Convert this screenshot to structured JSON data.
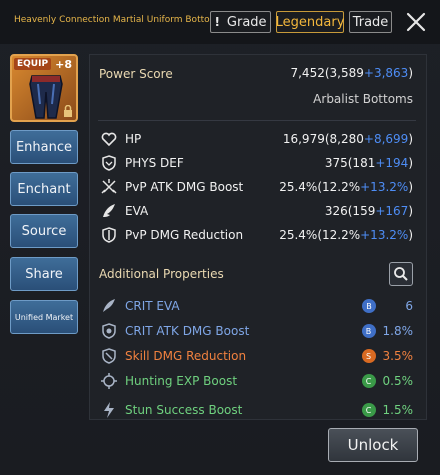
{
  "header": {
    "item_name": "Heavenly Connection Martial Uniform Bottom",
    "item_plus": "+8",
    "grade_label": "Grade",
    "legendary_label": "Legendary",
    "trade_label": "Trade"
  },
  "equip": {
    "tag": "EQUIP",
    "level": "+8"
  },
  "side_buttons": {
    "enhance": "Enhance",
    "enchant": "Enchant",
    "source": "Source",
    "share": "Share",
    "unified_market": "Unified Market"
  },
  "power": {
    "label": "Power Score",
    "value": "7,452",
    "base": "(3,589",
    "bonus": "+3,863",
    "close": ")",
    "item_type": "Arbalist Bottoms"
  },
  "stats": [
    {
      "name": "HP",
      "value": "16,979",
      "base": "(8,280",
      "bonus": "+8,699",
      "close": ")",
      "icon": "heart-icon"
    },
    {
      "name": "PHYS DEF",
      "value": "375",
      "base": "(181",
      "bonus": "+194",
      "close": ")",
      "icon": "shield-icon"
    },
    {
      "name": "PvP ATK DMG Boost",
      "value": "25.4%",
      "base": "(12.2%",
      "bonus": "+13.2%",
      "close": ")",
      "icon": "swords-icon"
    },
    {
      "name": "EVA",
      "value": "326",
      "base": "(159",
      "bonus": "+167",
      "close": ")",
      "icon": "wing-icon"
    },
    {
      "name": "PvP DMG Reduction",
      "value": "25.4%",
      "base": "(12.2%",
      "bonus": "+13.2%",
      "close": ")",
      "icon": "shield-sword-icon"
    }
  ],
  "additional": {
    "title": "Additional Properties",
    "items": [
      {
        "name": "CRIT EVA",
        "grade": "B",
        "value": "6",
        "color": "#7fa6e6",
        "badge_color": "#3f6fc6",
        "icon": "crit-eva-icon"
      },
      {
        "name": "CRIT ATK DMG Boost",
        "grade": "B",
        "value": "1.8%",
        "color": "#7fa6e6",
        "badge_color": "#3f6fc6",
        "icon": "crit-atk-icon"
      },
      {
        "name": "Skill DMG Reduction",
        "grade": "S",
        "value": "3.5%",
        "color": "#f0813f",
        "badge_color": "#d86a22",
        "icon": "skill-dmg-icon"
      },
      {
        "name": "Hunting EXP Boost",
        "grade": "C",
        "value": "0.5%",
        "color": "#6fd17f",
        "badge_color": "#3a9a48",
        "icon": "hunting-exp-icon"
      },
      {
        "name": "Stun Success Boost",
        "grade": "C",
        "value": "1.5%",
        "color": "#6fd17f",
        "badge_color": "#3a9a48",
        "icon": "stun-icon"
      }
    ]
  },
  "footer": {
    "unlock_label": "Unlock"
  }
}
